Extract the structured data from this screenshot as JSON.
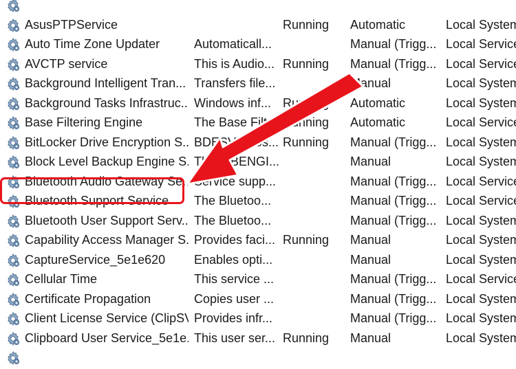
{
  "services": [
    {
      "name": "",
      "description": "",
      "status": "",
      "startup": "",
      "logon": ""
    },
    {
      "name": "AsusPTPService",
      "description": "",
      "status": "Running",
      "startup": "Automatic",
      "logon": "Local System"
    },
    {
      "name": "Auto Time Zone Updater",
      "description": "Automaticall...",
      "status": "",
      "startup": "Manual (Trigg...",
      "logon": "Local Service"
    },
    {
      "name": "AVCTP service",
      "description": "This is Audio...",
      "status": "Running",
      "startup": "Manual (Trigg...",
      "logon": "Local Service"
    },
    {
      "name": "Background Intelligent Tran...",
      "description": "Transfers file...",
      "status": "",
      "startup": "Manual",
      "logon": "Local System"
    },
    {
      "name": "Background Tasks Infrastruc...",
      "description": "Windows inf...",
      "status": "Running",
      "startup": "Automatic",
      "logon": "Local System"
    },
    {
      "name": "Base Filtering Engine",
      "description": "The Base Filt...",
      "status": "Running",
      "startup": "Automatic",
      "logon": "Local Service"
    },
    {
      "name": "BitLocker Drive Encryption S...",
      "description": "BDESVC hos...",
      "status": "Running",
      "startup": "Manual (Trigg...",
      "logon": "Local System"
    },
    {
      "name": "Block Level Backup Engine S...",
      "description": "The WBENGI...",
      "status": "",
      "startup": "Manual",
      "logon": "Local System"
    },
    {
      "name": "Bluetooth Audio Gateway Se...",
      "description": "Service supp...",
      "status": "",
      "startup": "Manual (Trigg...",
      "logon": "Local Service"
    },
    {
      "name": "Bluetooth Support Service",
      "description": "The Bluetoo...",
      "status": "",
      "startup": "Manual (Trigg...",
      "logon": "Local Service"
    },
    {
      "name": "Bluetooth User Support Serv...",
      "description": "The Bluetoo...",
      "status": "",
      "startup": "Manual (Trigg...",
      "logon": "Local System"
    },
    {
      "name": "Capability Access Manager S...",
      "description": "Provides faci...",
      "status": "Running",
      "startup": "Manual",
      "logon": "Local System"
    },
    {
      "name": "CaptureService_5e1e620",
      "description": "Enables opti...",
      "status": "",
      "startup": "Manual",
      "logon": "Local System"
    },
    {
      "name": "Cellular Time",
      "description": "This service ...",
      "status": "",
      "startup": "Manual (Trigg...",
      "logon": "Local Service"
    },
    {
      "name": "Certificate Propagation",
      "description": "Copies user ...",
      "status": "",
      "startup": "Manual (Trigg...",
      "logon": "Local System"
    },
    {
      "name": "Client License Service (ClipSV...",
      "description": "Provides infr...",
      "status": "",
      "startup": "Manual (Trigg...",
      "logon": "Local System"
    },
    {
      "name": "Clipboard User Service_5e1e...",
      "description": "This user ser...",
      "status": "Running",
      "startup": "Manual",
      "logon": "Local System"
    },
    {
      "name": "",
      "description": "",
      "status": "",
      "startup": "",
      "logon": ""
    }
  ],
  "highlighted_service": "Bluetooth Support Service",
  "colors": {
    "annotation": "#e8141b",
    "gear": "#5a7fa6",
    "text": "#1a1a1a"
  },
  "icons": {
    "service": "gear-icon",
    "annotation_arrow": "arrow-icon"
  }
}
